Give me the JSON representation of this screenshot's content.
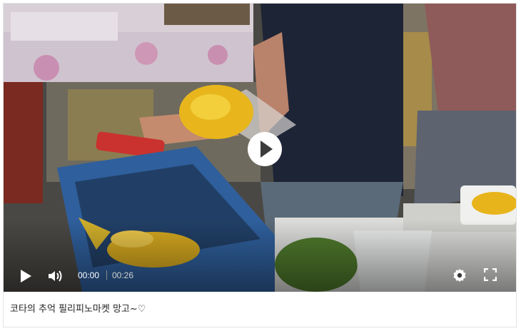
{
  "player": {
    "current_time": "00:00",
    "duration": "00:26"
  },
  "icons": {
    "big_play": "play-circle-icon",
    "play": "play-icon",
    "volume": "volume-icon",
    "settings": "gear-icon",
    "fullscreen": "fullscreen-icon"
  },
  "caption": {
    "text": "코타의 추억 필리피노마켓 망고~♡"
  }
}
